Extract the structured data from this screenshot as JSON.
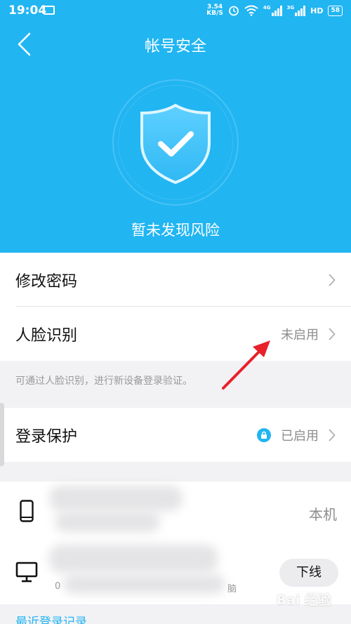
{
  "status_bar": {
    "time": "19:04",
    "net_speed_value": "3.54",
    "net_speed_unit": "KB/S",
    "network_4g": "4G",
    "network_3g": "3G",
    "hd": "HD",
    "battery": "58"
  },
  "header": {
    "title": "帐号安全",
    "status_text": "暂未发现风险"
  },
  "security_items": [
    {
      "label": "修改密码",
      "value": ""
    },
    {
      "label": "人脸识别",
      "value": "未启用"
    }
  ],
  "face_hint": "可通过人脸识别，进行新设备登录验证。",
  "login_protection": {
    "label": "登录保护",
    "value": "已启用"
  },
  "devices": {
    "current_label": "本机",
    "offline_label": "下线",
    "fragment_left": "0",
    "fragment_right": "脑"
  },
  "recent_login": "最近登录记录...",
  "watermark": "Bai 经验",
  "colors": {
    "accent": "#21b5f2",
    "annotation": "#e8212a"
  }
}
